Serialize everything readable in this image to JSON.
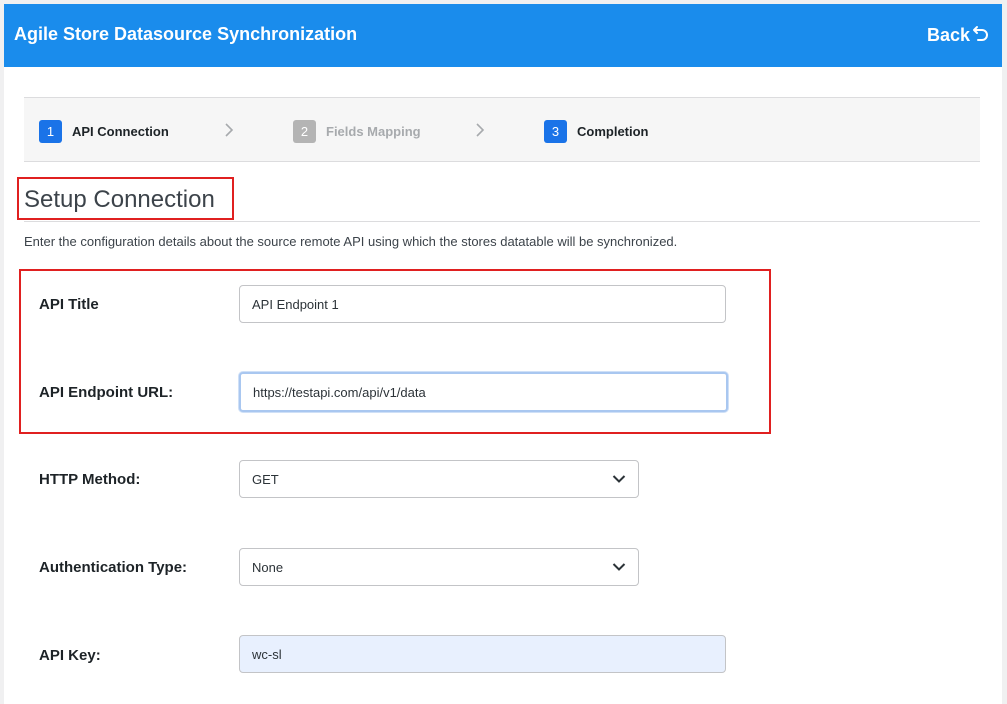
{
  "header": {
    "title": "Agile Store Datasource Synchronization",
    "back_label": "Back"
  },
  "steps": [
    {
      "number": "1",
      "label": "API Connection",
      "state": "active"
    },
    {
      "number": "2",
      "label": "Fields Mapping",
      "state": "disabled"
    },
    {
      "number": "3",
      "label": "Completion",
      "state": "active"
    }
  ],
  "section": {
    "title": "Setup Connection",
    "description": "Enter the configuration details about the source remote API using which the stores datatable will be synchronized."
  },
  "form": {
    "api_title": {
      "label": "API Title",
      "value": "API Endpoint 1"
    },
    "api_url": {
      "label": "API Endpoint URL:",
      "value": "https://testapi.com/api/v1/data"
    },
    "http_method": {
      "label": "HTTP Method:",
      "value": "GET"
    },
    "auth_type": {
      "label": "Authentication Type:",
      "value": "None"
    },
    "api_key": {
      "label": "API Key:",
      "value": "wc-sl"
    }
  },
  "colors": {
    "header_bg": "#1a8cec",
    "step_active": "#1a73e8",
    "step_disabled": "#b4b4b4",
    "highlight": "#e02020"
  },
  "icons": {
    "back": "undo-arrow-icon",
    "step_separator": "chevron-right-icon",
    "select": "chevron-down-icon"
  }
}
